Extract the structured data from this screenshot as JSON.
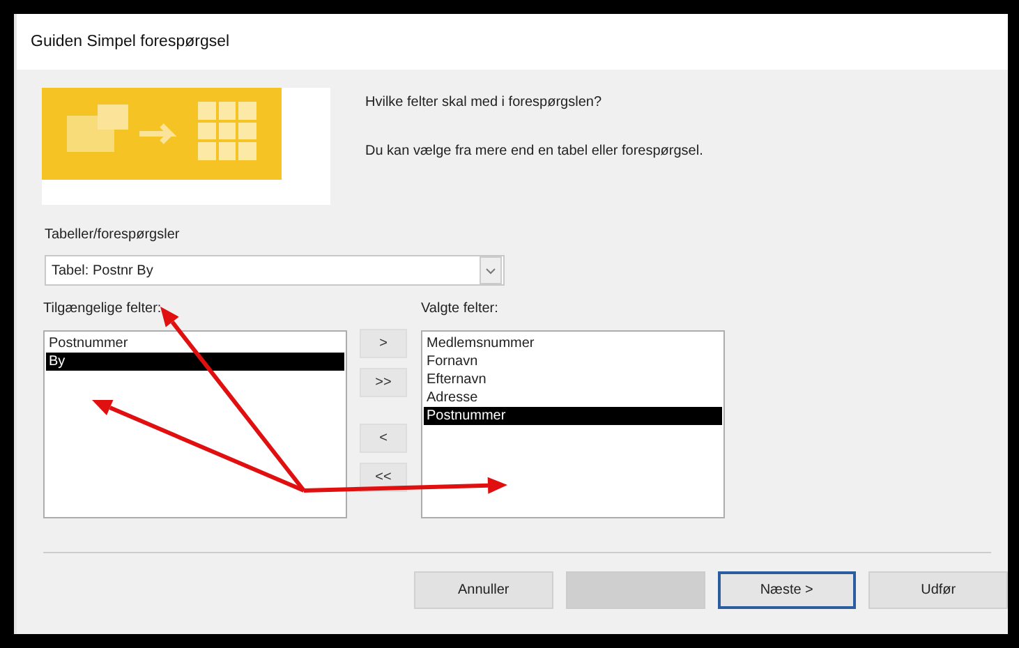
{
  "window": {
    "title": "Guiden Simpel forespørgsel"
  },
  "intro": [
    "Hvilke felter skal med i forespørgslen?",
    "Du kan vælge fra mere end en tabel eller forespørgsel."
  ],
  "source": {
    "label": "Tabeller/forespørgsler",
    "value": "Tabel: Postnr By"
  },
  "available": {
    "label": "Tilgængelige felter:",
    "items": [
      {
        "text": "Postnummer",
        "selected": false
      },
      {
        "text": "By",
        "selected": true
      }
    ]
  },
  "move_buttons": [
    ">",
    ">>",
    "<",
    "<<"
  ],
  "selected_fields": {
    "label": "Valgte felter:",
    "items": [
      {
        "text": "Medlemsnummer",
        "selected": false
      },
      {
        "text": "Fornavn",
        "selected": false
      },
      {
        "text": "Efternavn",
        "selected": false
      },
      {
        "text": "Adresse",
        "selected": false
      },
      {
        "text": "Postnummer",
        "selected": true
      }
    ]
  },
  "buttons": [
    {
      "label": "Annuller",
      "disabled": false,
      "default": false
    },
    {
      "disabled": true,
      "default": false
    },
    {
      "label": "Næste >",
      "disabled": false,
      "default": true
    },
    {
      "label": "Udfør",
      "disabled": false,
      "default": false
    }
  ],
  "annotation": {
    "kind": "arrows"
  }
}
